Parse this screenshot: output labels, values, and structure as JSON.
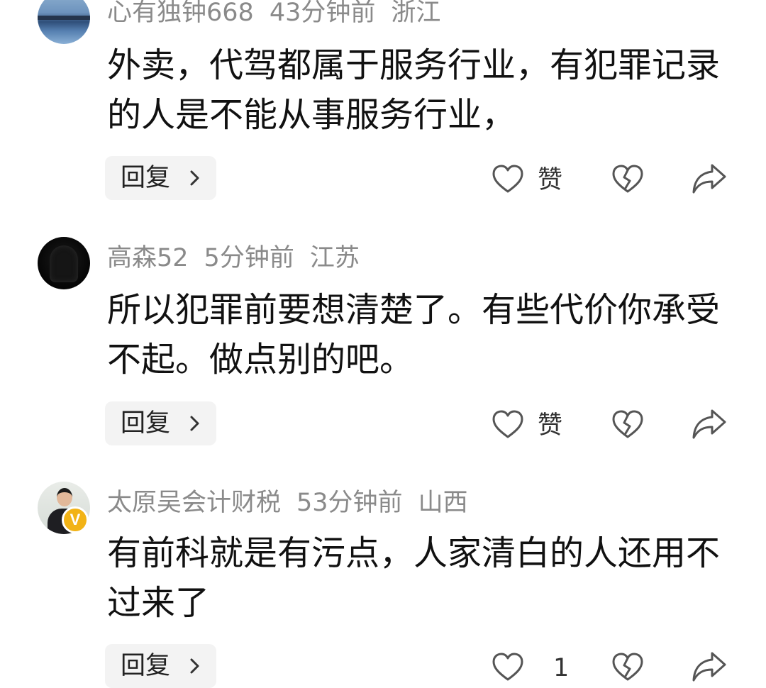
{
  "comments": [
    {
      "username": "心有独钟668",
      "time": "43分钟前",
      "location": "浙江",
      "text": "外卖，代驾都属于服务行业，有犯罪记录的人是不能从事服务行业，",
      "reply_label": "回复",
      "like_label": "赞",
      "avatar_icon": "city-skyline-avatar"
    },
    {
      "username": "高森52",
      "time": "5分钟前",
      "location": "江苏",
      "text": "所以犯罪前要想清楚了。有些代价你承受不起。做点别的吧。",
      "reply_label": "回复",
      "like_label": "赞",
      "avatar_icon": "hooded-figure-avatar"
    },
    {
      "username": "太原吴会计财税",
      "time": "53分钟前",
      "location": "山西",
      "text": "有前科就是有污点，人家清白的人还用不过来了",
      "reply_label": "回复",
      "like_label": "1",
      "avatar_icon": "person-avatar",
      "verified_badge": "V"
    }
  ],
  "colors": {
    "meta_text": "#8a8a8a",
    "body_text": "#111111",
    "reply_bg": "#f3f3f3",
    "icon_stroke": "#555555",
    "verified_badge": "#f2b316"
  }
}
